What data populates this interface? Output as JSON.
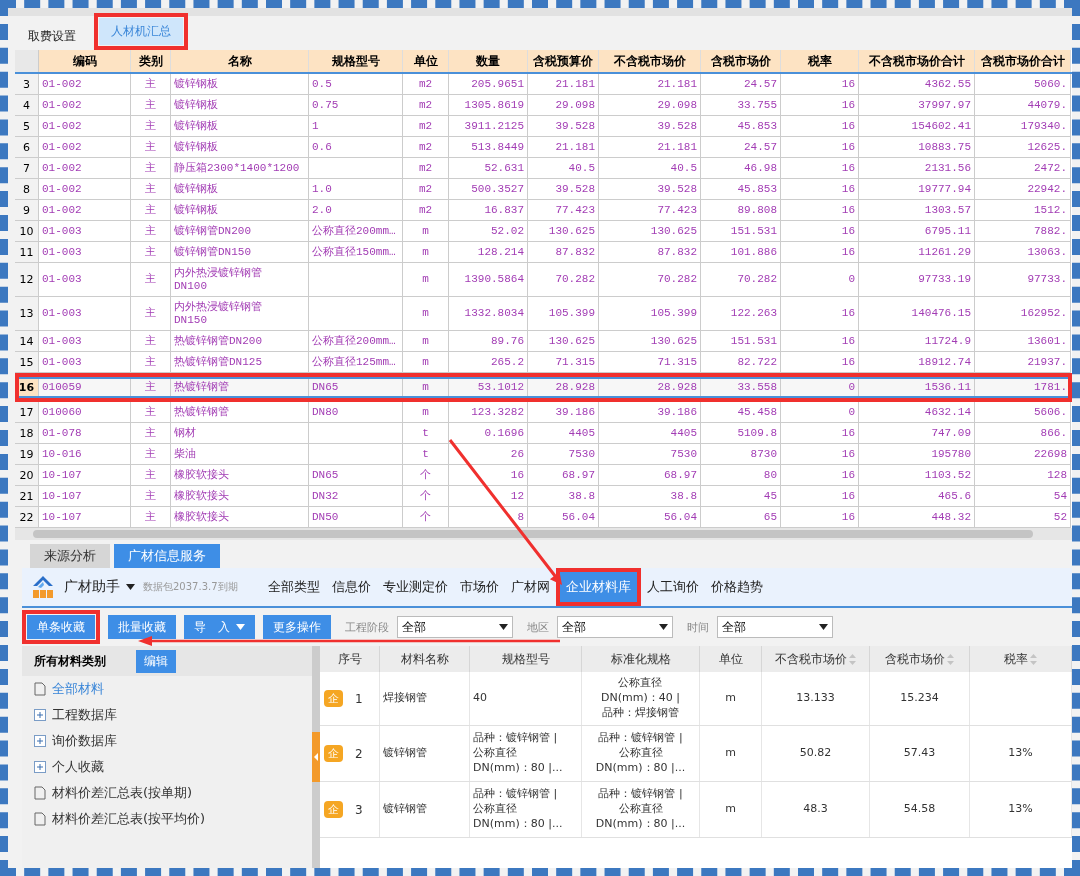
{
  "top_tabs": [
    {
      "label": "取费设置",
      "selected": false,
      "highlighted": false
    },
    {
      "label": "人材机汇总",
      "selected": true,
      "highlighted": true
    }
  ],
  "summary_table": {
    "columns": [
      "编码",
      "类别",
      "名称",
      "规格型号",
      "单位",
      "数量",
      "含税预算价",
      "不含税市场价",
      "含税市场价",
      "税率",
      "不含税市场价合计",
      "含税市场价合计"
    ],
    "rows": [
      {
        "no": "3",
        "selected": false,
        "highlighted": false,
        "code": "01-002",
        "type": "主",
        "name": "镀锌钢板",
        "spec": "0.5",
        "unit": "m2",
        "qty": "205.9651",
        "budget": "21.181",
        "price_ex": "21.181",
        "price_in": "24.57",
        "tax": "16",
        "total_ex": "4362.55",
        "total_in": "5060."
      },
      {
        "no": "4",
        "selected": false,
        "highlighted": false,
        "code": "01-002",
        "type": "主",
        "name": "镀锌钢板",
        "spec": "0.75",
        "unit": "m2",
        "qty": "1305.8619",
        "budget": "29.098",
        "price_ex": "29.098",
        "price_in": "33.755",
        "tax": "16",
        "total_ex": "37997.97",
        "total_in": "44079."
      },
      {
        "no": "5",
        "selected": false,
        "highlighted": false,
        "code": "01-002",
        "type": "主",
        "name": "镀锌钢板",
        "spec": "1",
        "unit": "m2",
        "qty": "3911.2125",
        "budget": "39.528",
        "price_ex": "39.528",
        "price_in": "45.853",
        "tax": "16",
        "total_ex": "154602.41",
        "total_in": "179340."
      },
      {
        "no": "6",
        "selected": false,
        "highlighted": false,
        "code": "01-002",
        "type": "主",
        "name": "镀锌钢板",
        "spec": "0.6",
        "unit": "m2",
        "qty": "513.8449",
        "budget": "21.181",
        "price_ex": "21.181",
        "price_in": "24.57",
        "tax": "16",
        "total_ex": "10883.75",
        "total_in": "12625."
      },
      {
        "no": "7",
        "selected": false,
        "highlighted": false,
        "code": "01-002",
        "type": "主",
        "name": "静压箱2300*1400*1200",
        "unit": "m2",
        "qty": "52.631",
        "budget": "40.5",
        "price_ex": "40.5",
        "price_in": "46.98",
        "tax": "16",
        "total_ex": "2131.56",
        "total_in": "2472."
      },
      {
        "no": "8",
        "selected": false,
        "highlighted": false,
        "code": "01-002",
        "type": "主",
        "name": "镀锌钢板",
        "spec": "1.0",
        "unit": "m2",
        "qty": "500.3527",
        "budget": "39.528",
        "price_ex": "39.528",
        "price_in": "45.853",
        "tax": "16",
        "total_ex": "19777.94",
        "total_in": "22942."
      },
      {
        "no": "9",
        "selected": false,
        "highlighted": false,
        "code": "01-002",
        "type": "主",
        "name": "镀锌钢板",
        "spec": "2.0",
        "unit": "m2",
        "qty": "16.837",
        "budget": "77.423",
        "price_ex": "77.423",
        "price_in": "89.808",
        "tax": "16",
        "total_ex": "1303.57",
        "total_in": "1512."
      },
      {
        "no": "10",
        "selected": false,
        "highlighted": false,
        "code": "01-003",
        "type": "主",
        "name": "镀锌钢管DN200",
        "spec": "公称直径200mm…",
        "unit": "m",
        "qty": "52.02",
        "budget": "130.625",
        "price_ex": "130.625",
        "price_in": "151.531",
        "tax": "16",
        "total_ex": "6795.11",
        "total_in": "7882."
      },
      {
        "no": "11",
        "selected": false,
        "highlighted": false,
        "code": "01-003",
        "type": "主",
        "name": "镀锌钢管DN150",
        "spec": "公称直径150mm…",
        "unit": "m",
        "qty": "128.214",
        "budget": "87.832",
        "price_ex": "87.832",
        "price_in": "101.886",
        "tax": "16",
        "total_ex": "11261.29",
        "total_in": "13063."
      },
      {
        "no": "12",
        "selected": false,
        "highlighted": false,
        "code": "01-003",
        "type": "主",
        "name": "内外热浸镀锌钢管\nDN100",
        "unit": "m",
        "qty": "1390.5864",
        "budget": "70.282",
        "price_ex": "70.282",
        "price_in": "70.282",
        "tax": "0",
        "total_ex": "97733.19",
        "total_in": "97733."
      },
      {
        "no": "13",
        "selected": false,
        "highlighted": false,
        "code": "01-003",
        "type": "主",
        "name": "内外热浸镀锌钢管\nDN150",
        "unit": "m",
        "qty": "1332.8034",
        "budget": "105.399",
        "price_ex": "105.399",
        "price_in": "122.263",
        "tax": "16",
        "total_ex": "140476.15",
        "total_in": "162952."
      },
      {
        "no": "14",
        "selected": false,
        "highlighted": false,
        "code": "01-003",
        "type": "主",
        "name": "热镀锌钢管DN200",
        "spec": "公称直径200mm…",
        "unit": "m",
        "qty": "89.76",
        "budget": "130.625",
        "price_ex": "130.625",
        "price_in": "151.531",
        "tax": "16",
        "total_ex": "11724.9",
        "total_in": "13601."
      },
      {
        "no": "15",
        "selected": false,
        "highlighted": false,
        "code": "01-003",
        "type": "主",
        "name": "热镀锌钢管DN125",
        "spec": "公称直径125mm…",
        "unit": "m",
        "qty": "265.2",
        "budget": "71.315",
        "price_ex": "71.315",
        "price_in": "82.722",
        "tax": "16",
        "total_ex": "18912.74",
        "total_in": "21937."
      },
      {
        "no": "16",
        "selected": true,
        "highlighted": true,
        "code": "010059",
        "type": "主",
        "name": "热镀锌钢管",
        "spec": "DN65",
        "unit": "m",
        "qty": "53.1012",
        "budget": "28.928",
        "price_ex": "28.928",
        "price_in": "33.558",
        "tax": "0",
        "total_ex": "1536.11",
        "total_in": "1781."
      },
      {
        "no": "17",
        "selected": false,
        "highlighted": false,
        "code": "010060",
        "type": "主",
        "name": "热镀锌钢管",
        "spec": "DN80",
        "unit": "m",
        "qty": "123.3282",
        "budget": "39.186",
        "price_ex": "39.186",
        "price_in": "45.458",
        "tax": "0",
        "total_ex": "4632.14",
        "total_in": "5606."
      },
      {
        "no": "18",
        "selected": false,
        "highlighted": false,
        "code": "01-078",
        "type": "主",
        "name": "钢材",
        "unit": "t",
        "qty": "0.1696",
        "budget": "4405",
        "price_ex": "4405",
        "price_in": "5109.8",
        "tax": "16",
        "total_ex": "747.09",
        "total_in": "866."
      },
      {
        "no": "19",
        "selected": false,
        "highlighted": false,
        "code": "10-016",
        "type": "主",
        "name": "柴油",
        "unit": "t",
        "qty": "26",
        "budget": "7530",
        "price_ex": "7530",
        "price_in": "8730",
        "tax": "16",
        "total_ex": "195780",
        "total_in": "22698"
      },
      {
        "no": "20",
        "selected": false,
        "highlighted": false,
        "code": "10-107",
        "type": "主",
        "name": "橡胶软接头",
        "spec": "DN65",
        "unit": "个",
        "qty": "16",
        "budget": "68.97",
        "price_ex": "68.97",
        "price_in": "80",
        "tax": "16",
        "total_ex": "1103.52",
        "total_in": "128"
      },
      {
        "no": "21",
        "selected": false,
        "highlighted": false,
        "code": "10-107",
        "type": "主",
        "name": "橡胶软接头",
        "spec": "DN32",
        "unit": "个",
        "qty": "12",
        "budget": "38.8",
        "price_ex": "38.8",
        "price_in": "45",
        "tax": "16",
        "total_ex": "465.6",
        "total_in": "54"
      },
      {
        "no": "22",
        "selected": false,
        "highlighted": false,
        "code": "10-107",
        "type": "主",
        "name": "橡胶软接头",
        "spec": "DN50",
        "unit": "个",
        "qty": "8",
        "budget": "56.04",
        "price_ex": "56.04",
        "price_in": "65",
        "tax": "16",
        "total_ex": "448.32",
        "total_in": "52"
      }
    ]
  },
  "bottom_tabs": [
    {
      "label": "来源分析",
      "selected": false
    },
    {
      "label": "广材信息服务",
      "selected": true
    }
  ],
  "service_bar": {
    "app_name": "广材助手",
    "package_note": "数据包2037.3.7到期",
    "categories": [
      {
        "label": "全部类型",
        "selected": false,
        "highlighted": false
      },
      {
        "label": "信息价",
        "selected": false,
        "highlighted": false
      },
      {
        "label": "专业测定价",
        "selected": false,
        "highlighted": false
      },
      {
        "label": "市场价",
        "selected": false,
        "highlighted": false
      },
      {
        "label": "广材网",
        "selected": false,
        "highlighted": false
      },
      {
        "label": "企业材料库",
        "selected": true,
        "highlighted": true
      },
      {
        "label": "人工询价",
        "selected": false,
        "highlighted": false
      },
      {
        "label": "价格趋势",
        "selected": false,
        "highlighted": false
      }
    ]
  },
  "actions": [
    {
      "label": "单条收藏",
      "kind": "plain",
      "highlighted": true
    },
    {
      "label": "批量收藏",
      "kind": "plain",
      "highlighted": false
    },
    {
      "label": "导　入",
      "kind": "dropdown",
      "highlighted": false
    },
    {
      "label": "更多操作",
      "kind": "plain",
      "highlighted": false
    }
  ],
  "filters": [
    {
      "label": "工程阶段",
      "value": "全部"
    },
    {
      "label": "地区",
      "value": "全部"
    },
    {
      "label": "时间",
      "value": "全部"
    }
  ],
  "category_panel": {
    "title": "所有材料类别",
    "edit_button": "编辑",
    "items": [
      {
        "label": "全部材料",
        "kind": "leaf",
        "selected": true
      },
      {
        "label": "工程数据库",
        "kind": "group",
        "selected": false,
        "expanded": false
      },
      {
        "label": "询价数据库",
        "kind": "group",
        "selected": false,
        "expanded": false
      },
      {
        "label": "个人收藏",
        "kind": "group",
        "selected": false,
        "expanded": false
      },
      {
        "label": "材料价差汇总表(按单期)",
        "kind": "leaf",
        "selected": false
      },
      {
        "label": "材料价差汇总表(按平均价)",
        "kind": "leaf",
        "selected": false
      }
    ]
  },
  "material_table": {
    "columns": [
      {
        "label": "序号",
        "sortable": false
      },
      {
        "label": "材料名称",
        "sortable": false
      },
      {
        "label": "规格型号",
        "sortable": false
      },
      {
        "label": "标准化规格",
        "sortable": false
      },
      {
        "label": "单位",
        "sortable": false
      },
      {
        "label": "不含税市场价",
        "sortable": true
      },
      {
        "label": "含税市场价",
        "sortable": true
      },
      {
        "label": "税率",
        "sortable": true
      }
    ],
    "rows": [
      {
        "badge": "企",
        "no": "1",
        "name": "焊接钢管",
        "spec": "40",
        "std_spec": "公称直径\nDN(mm)：40 |\n品种：焊接钢管",
        "unit": "m",
        "price_ex": "13.133",
        "price_in": "15.234"
      },
      {
        "badge": "企",
        "no": "2",
        "name": "镀锌钢管",
        "spec": "品种：镀锌钢管 |\n公称直径\nDN(mm)：80 |...",
        "std_spec": "品种：镀锌钢管 |\n公称直径\nDN(mm)：80 |...",
        "unit": "m",
        "price_ex": "50.82",
        "price_in": "57.43",
        "tax": "13%"
      },
      {
        "badge": "企",
        "no": "3",
        "name": "镀锌钢管",
        "spec": "品种：镀锌钢管 |\n公称直径\nDN(mm)：80 |...",
        "std_spec": "品种：镀锌钢管 |\n公称直径\nDN(mm)：80 |...",
        "unit": "m",
        "price_ex": "48.3",
        "price_in": "54.58",
        "tax": "13%"
      }
    ]
  }
}
